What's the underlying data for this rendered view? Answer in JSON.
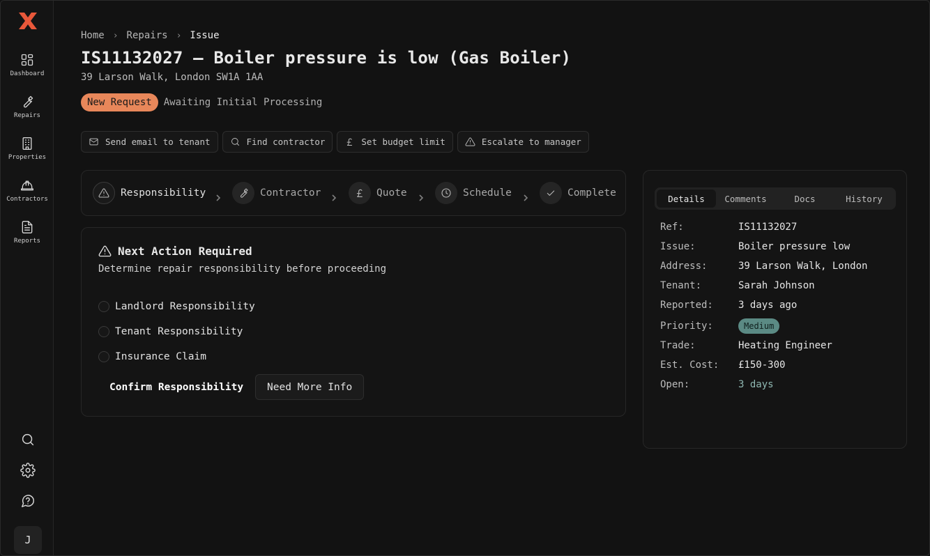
{
  "sidebar": {
    "nav": [
      {
        "label": "Dashboard",
        "icon": "grid-icon"
      },
      {
        "label": "Repairs",
        "icon": "wrench-icon"
      },
      {
        "label": "Properties",
        "icon": "building-icon"
      },
      {
        "label": "Contractors",
        "icon": "hard-hat-icon"
      },
      {
        "label": "Reports",
        "icon": "document-icon"
      }
    ],
    "tools": [
      "search-icon",
      "gear-icon",
      "help-icon"
    ],
    "avatar_initial": "J",
    "brand_color": "#e8583a"
  },
  "breadcrumb": {
    "items": [
      "Home",
      "Repairs",
      "Issue"
    ]
  },
  "page": {
    "title": "IS11132027 – Boiler pressure is low (Gas Boiler)",
    "address": "39 Larson Walk, London SW1A 1AA",
    "status_badge": "New Request",
    "status_text": "Awaiting Initial Processing"
  },
  "actions": [
    {
      "label": "Send email to tenant",
      "icon": "mail-icon"
    },
    {
      "label": "Find contractor",
      "icon": "search-icon"
    },
    {
      "label": "Set budget limit",
      "icon": "pound-icon"
    },
    {
      "label": "Escalate to manager",
      "icon": "warning-icon"
    }
  ],
  "stepper": {
    "steps": [
      {
        "label": "Responsibility",
        "icon": "warning-icon",
        "active": true
      },
      {
        "label": "Contractor",
        "icon": "wrench-icon"
      },
      {
        "label": "Quote",
        "icon": "pound-icon"
      },
      {
        "label": "Schedule",
        "icon": "clock-icon"
      },
      {
        "label": "Complete",
        "icon": "check-icon"
      }
    ]
  },
  "next_action": {
    "title": "Next Action Required",
    "subtitle": "Determine repair responsibility before proceeding",
    "options": [
      "Landlord Responsibility",
      "Tenant Responsibility",
      "Insurance Claim"
    ],
    "confirm_label": "Confirm Responsibility",
    "more_info_label": "Need More Info"
  },
  "details": {
    "tabs": [
      "Details",
      "Comments",
      "Docs",
      "History"
    ],
    "active_tab": "Details",
    "rows": [
      {
        "key": "Ref:",
        "value": "IS11132027"
      },
      {
        "key": "Issue:",
        "value": "Boiler pressure low"
      },
      {
        "key": "Address:",
        "value": "39 Larson Walk, London"
      },
      {
        "key": "Tenant:",
        "value": "Sarah Johnson"
      },
      {
        "key": "Reported:",
        "value": "3 days ago"
      },
      {
        "key": "Priority:",
        "value": "Medium"
      },
      {
        "key": "Trade:",
        "value": "Heating Engineer"
      },
      {
        "key": "Est. Cost:",
        "value": "£150-300"
      },
      {
        "key": "Open:",
        "value": "3 days"
      }
    ]
  },
  "colors": {
    "status_badge": "#e8875a",
    "priority_badge": "#5b8a84",
    "accent_text": "#8fb8b2"
  }
}
